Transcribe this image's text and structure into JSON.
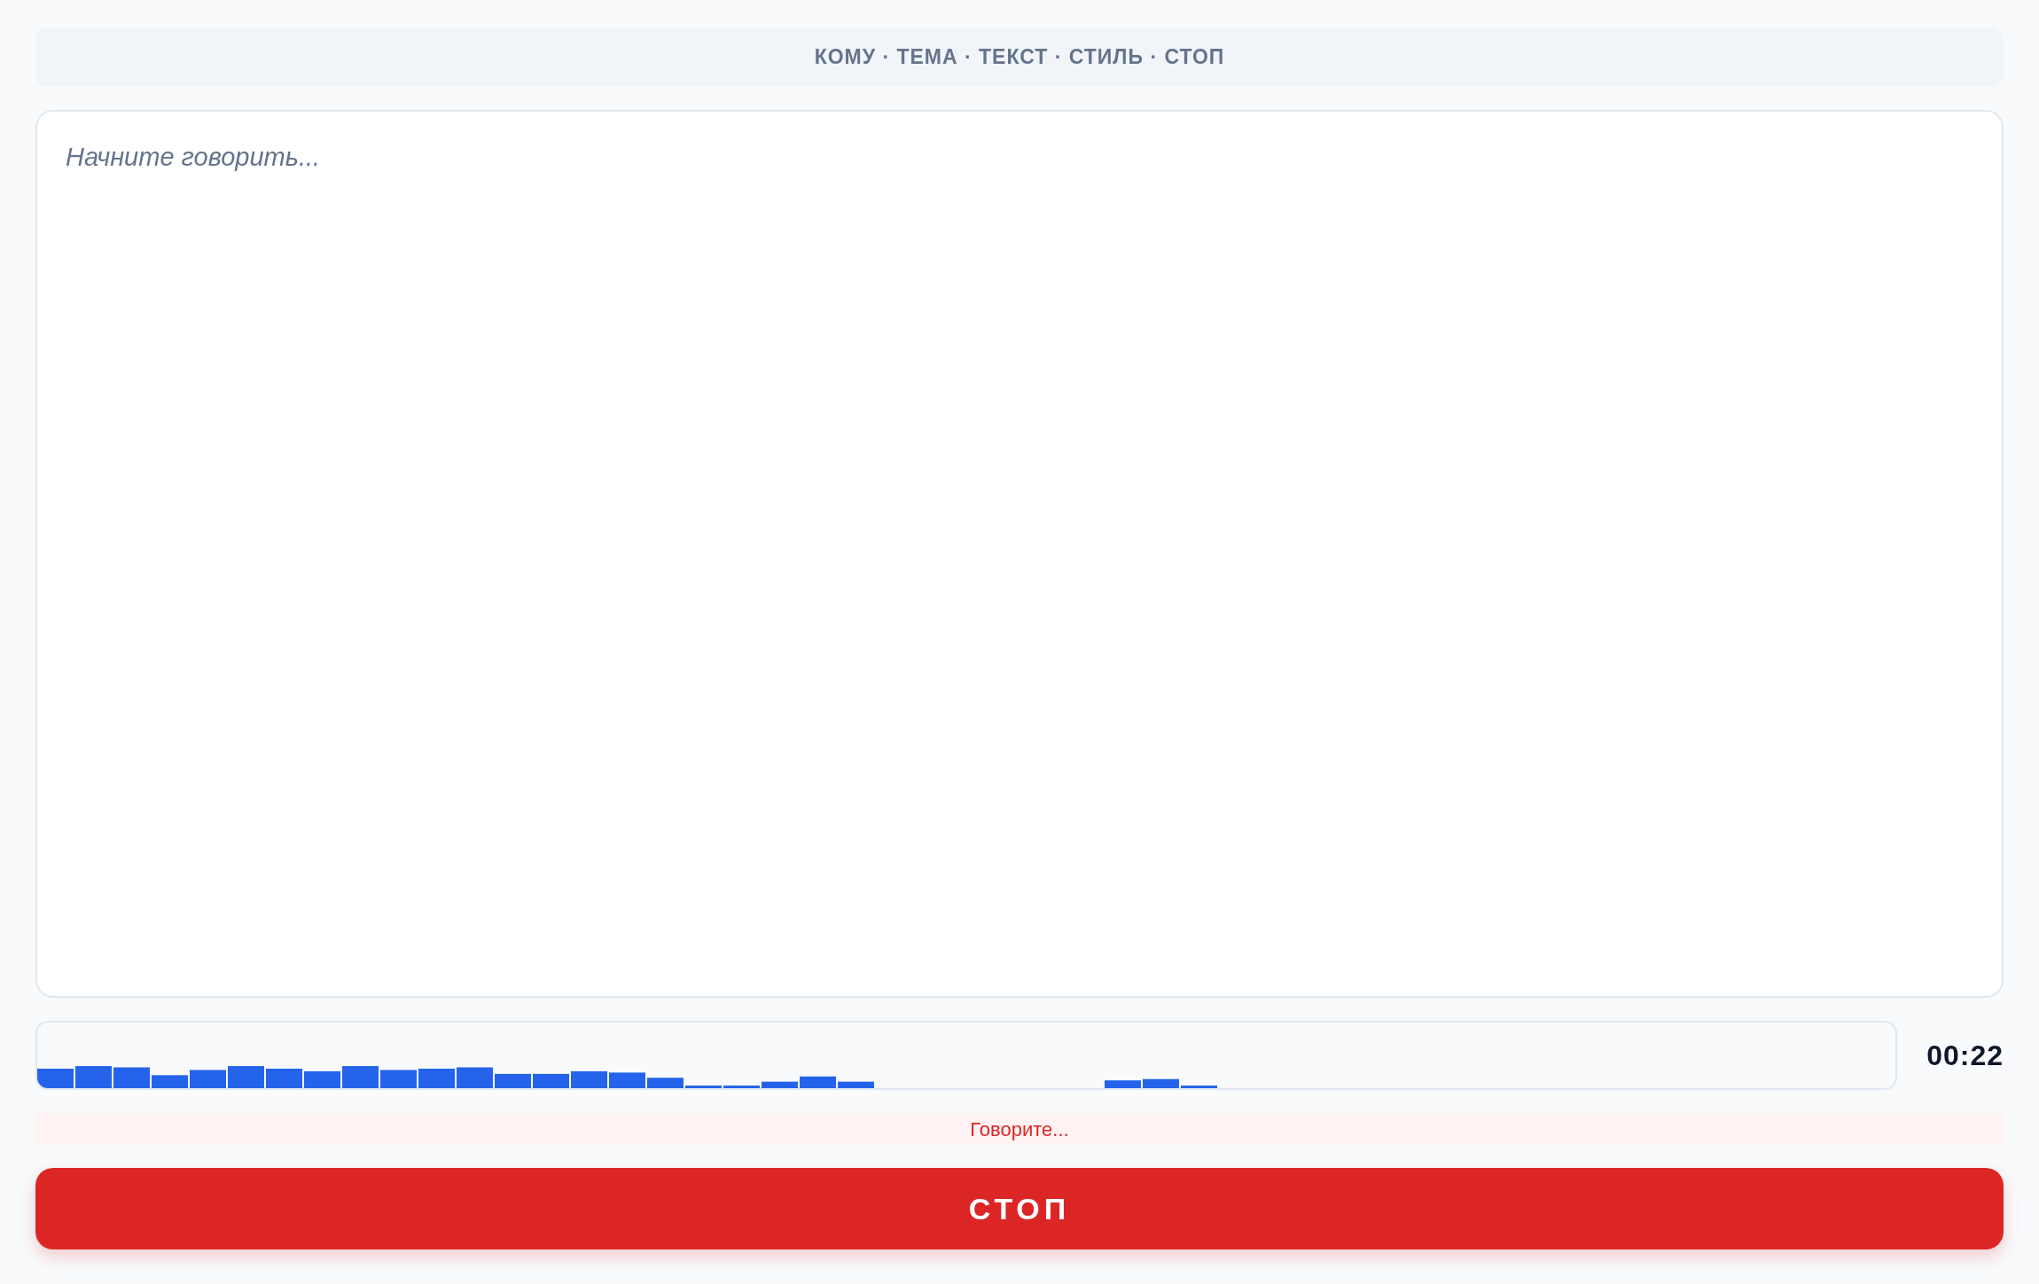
{
  "hint_bar": {
    "text": "КОМУ · ТЕМА · ТЕКСТ · СТИЛЬ · СТОП"
  },
  "transcript": {
    "placeholder": "Начните говорить..."
  },
  "recorder": {
    "timer": "00:22",
    "status": "Говорите..."
  },
  "stop_button": {
    "label": "СТОП"
  }
}
